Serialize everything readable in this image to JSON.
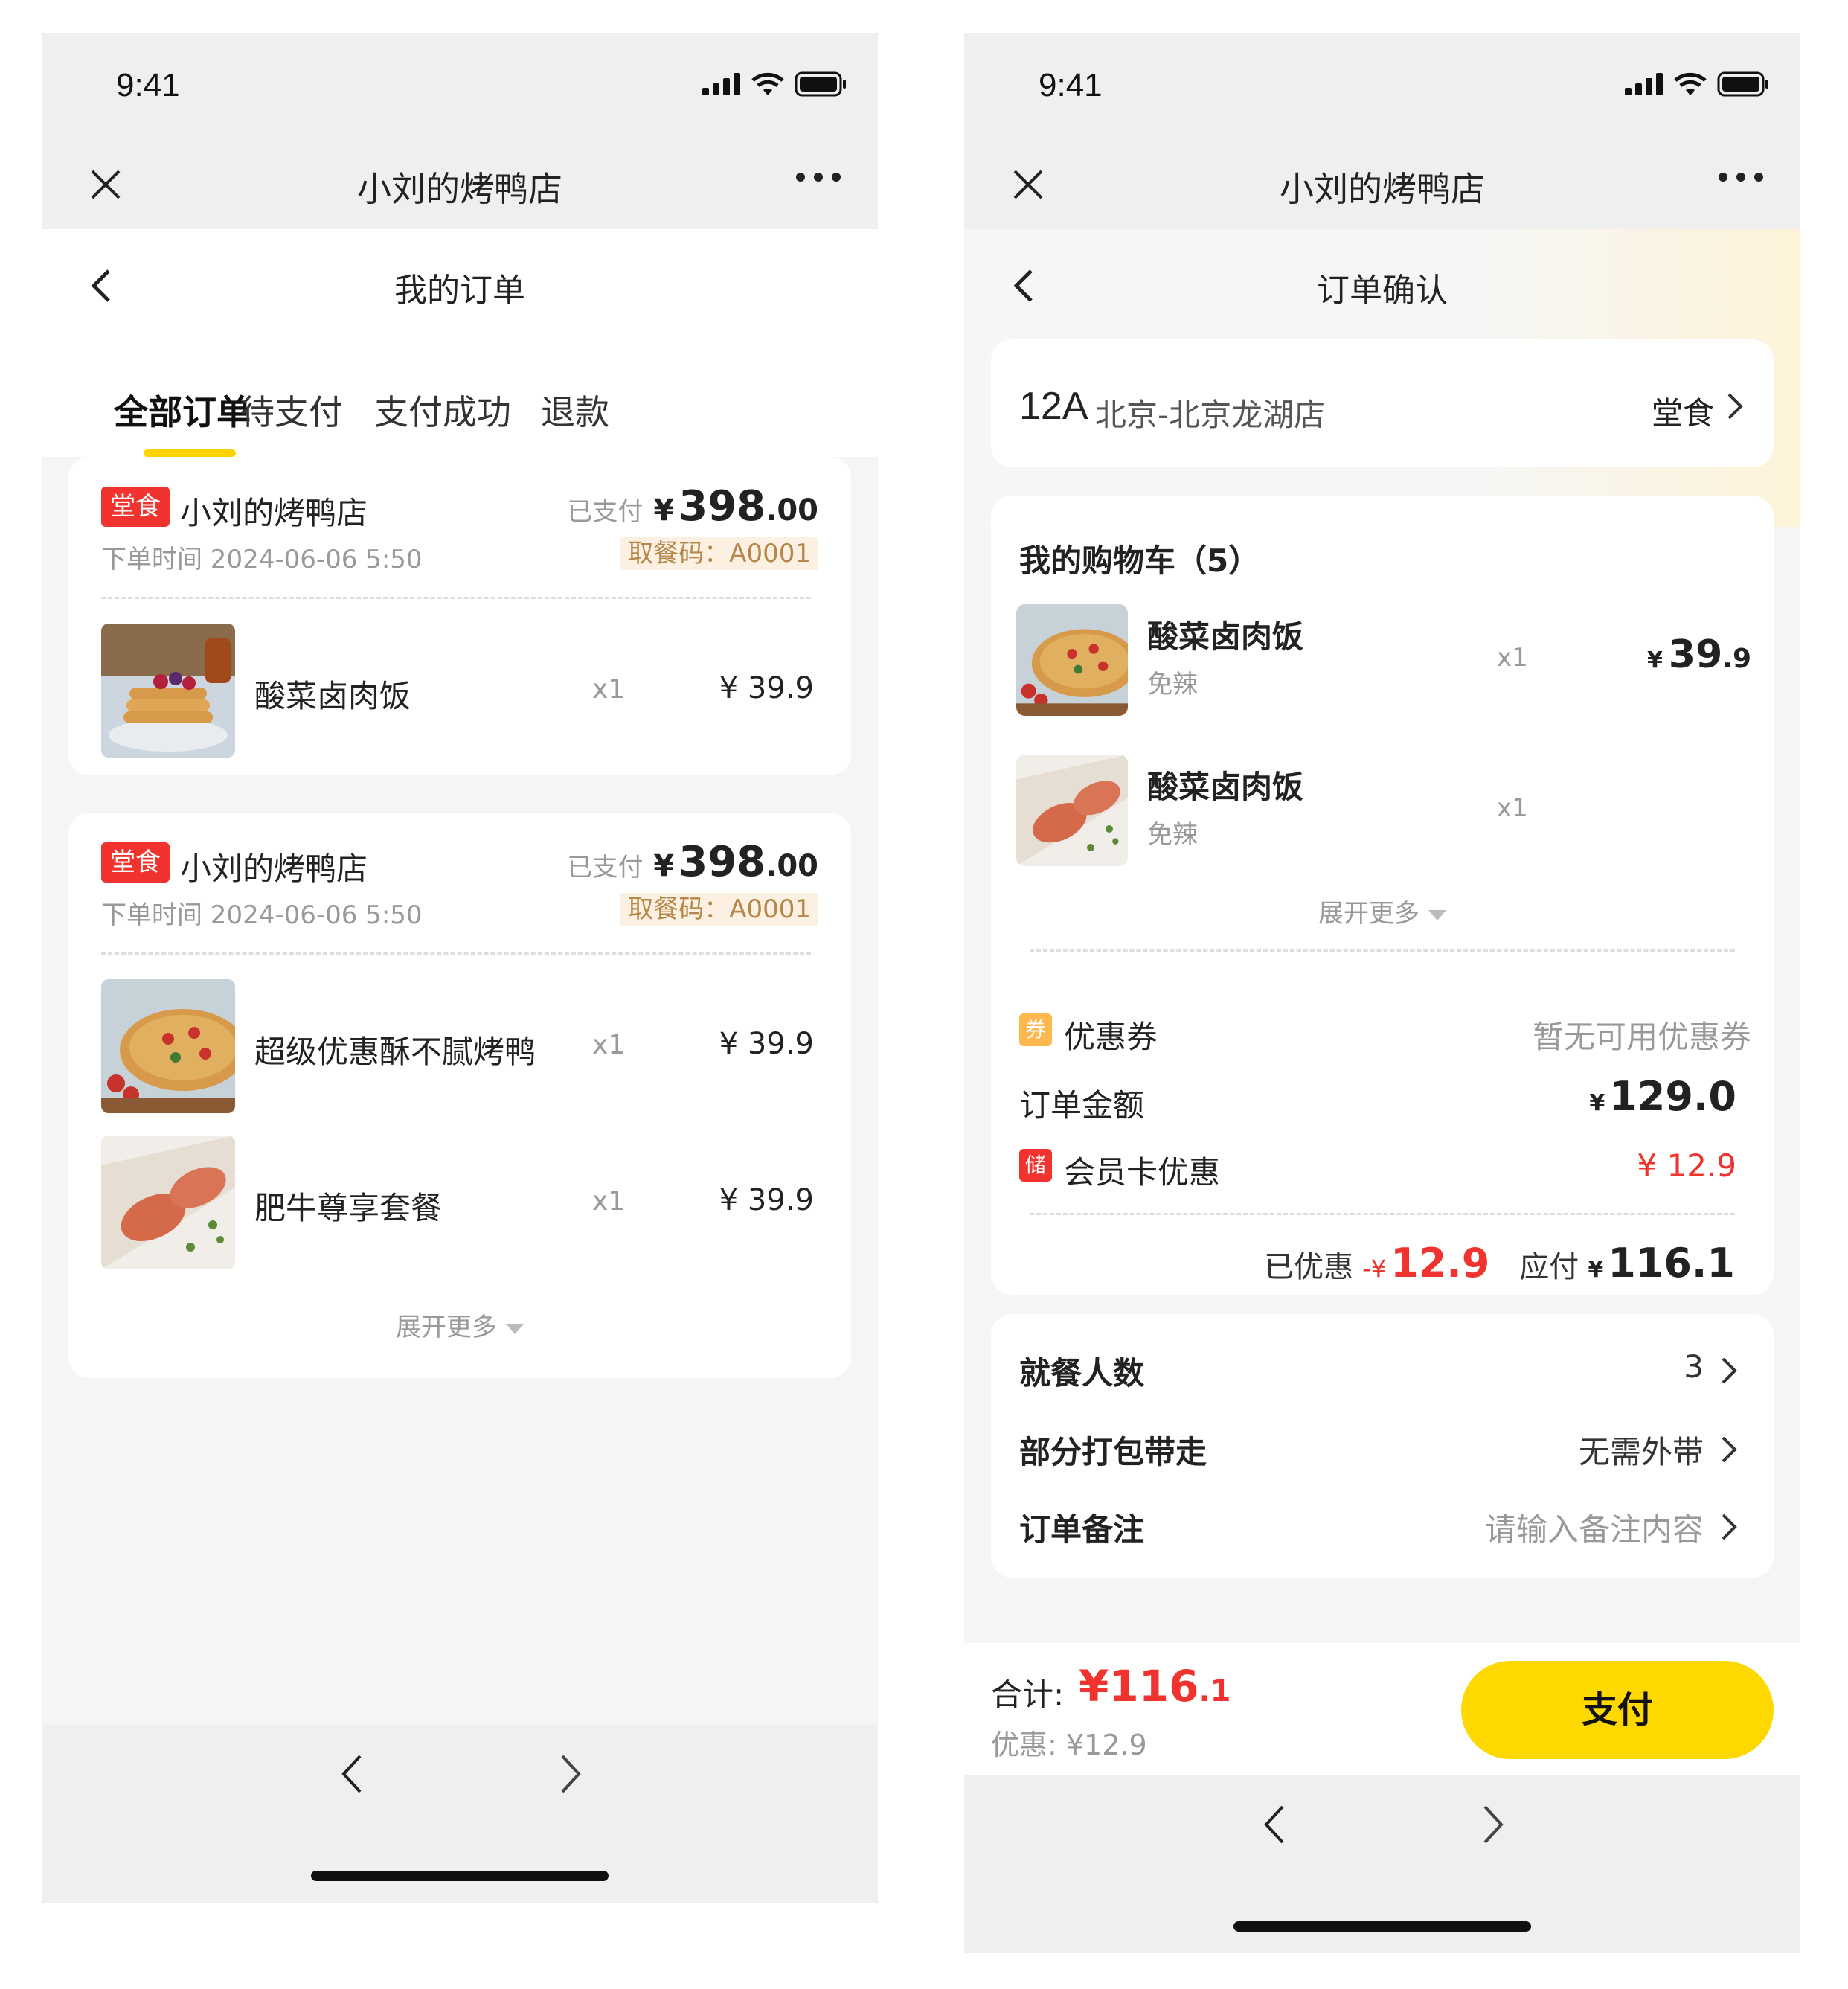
{
  "status_bar": {
    "time": "9:41"
  },
  "mini_program": {
    "title": "小刘的烤鸭店"
  },
  "left": {
    "page_title": "我的订单",
    "tabs": [
      "全部订单",
      "待支付",
      "支付成功",
      "退款"
    ],
    "orders": [
      {
        "tag": "堂食",
        "shop": "小刘的烤鸭店",
        "time": "下单时间 2024-06-06 5:50",
        "paid_label": "已支付",
        "currency": "¥",
        "amount_int": "398",
        "amount_dec": ".00",
        "pickup": "取餐码：A0001",
        "items": [
          {
            "name": "酸菜卤肉饭",
            "qty": "x1",
            "price": "¥ 39.9"
          }
        ]
      },
      {
        "tag": "堂食",
        "shop": "小刘的烤鸭店",
        "time": "下单时间 2024-06-06 5:50",
        "paid_label": "已支付",
        "currency": "¥",
        "amount_int": "398",
        "amount_dec": ".00",
        "pickup": "取餐码：A0001",
        "items": [
          {
            "name": "超级优惠酥不腻烤鸭",
            "qty": "x1",
            "price": "¥ 39.9"
          },
          {
            "name": "肥牛尊享套餐",
            "qty": "x1",
            "price": "¥ 39.9"
          }
        ],
        "more": "展开更多"
      }
    ]
  },
  "right": {
    "page_title": "订单确认",
    "table_no": "12A",
    "store": "北京-北京龙湖店",
    "dine_mode": "堂食",
    "cart_title": "我的购物车（5）",
    "cart_items": [
      {
        "name": "酸菜卤肉饭",
        "spec": "免辣",
        "qty": "x1",
        "currency": "¥",
        "price_int": "39",
        "price_dec": ".9"
      },
      {
        "name": "酸菜卤肉饭",
        "spec": "免辣",
        "qty": "x1"
      }
    ],
    "more": "展开更多",
    "coupon_icon": "券",
    "coupon_label": "优惠券",
    "coupon_value": "暂无可用优惠券",
    "order_amount_label": "订单金额",
    "order_amount_currency": "¥",
    "order_amount": "129.0",
    "member_icon": "储",
    "member_label": "会员卡优惠",
    "member_value": "¥ 12.9",
    "discounted_label": "已优惠",
    "discounted_prefix": "-¥",
    "discounted_value": "12.9",
    "payable_label": "应付",
    "payable_currency": "¥",
    "payable_value": "116.1",
    "settings": [
      {
        "label": "就餐人数",
        "value": "3"
      },
      {
        "label": "部分打包带走",
        "value": "无需外带"
      },
      {
        "label": "订单备注",
        "value": "请输入备注内容"
      }
    ],
    "total_label": "合计:",
    "total_int": "¥116",
    "total_dec": ".1",
    "discount_line": "优惠: ¥12.9",
    "pay_button": "支付"
  },
  "colors": {
    "accent_yellow": "#ffd800",
    "price_red": "#f0332e",
    "pickup_bg": "#fbf0e2",
    "pickup_text": "#b5884a"
  },
  "icons": [
    "close-icon",
    "more-icon",
    "back-icon",
    "chevron-right-icon",
    "caret-down-icon",
    "signal-icon",
    "wifi-icon",
    "battery-icon"
  ]
}
